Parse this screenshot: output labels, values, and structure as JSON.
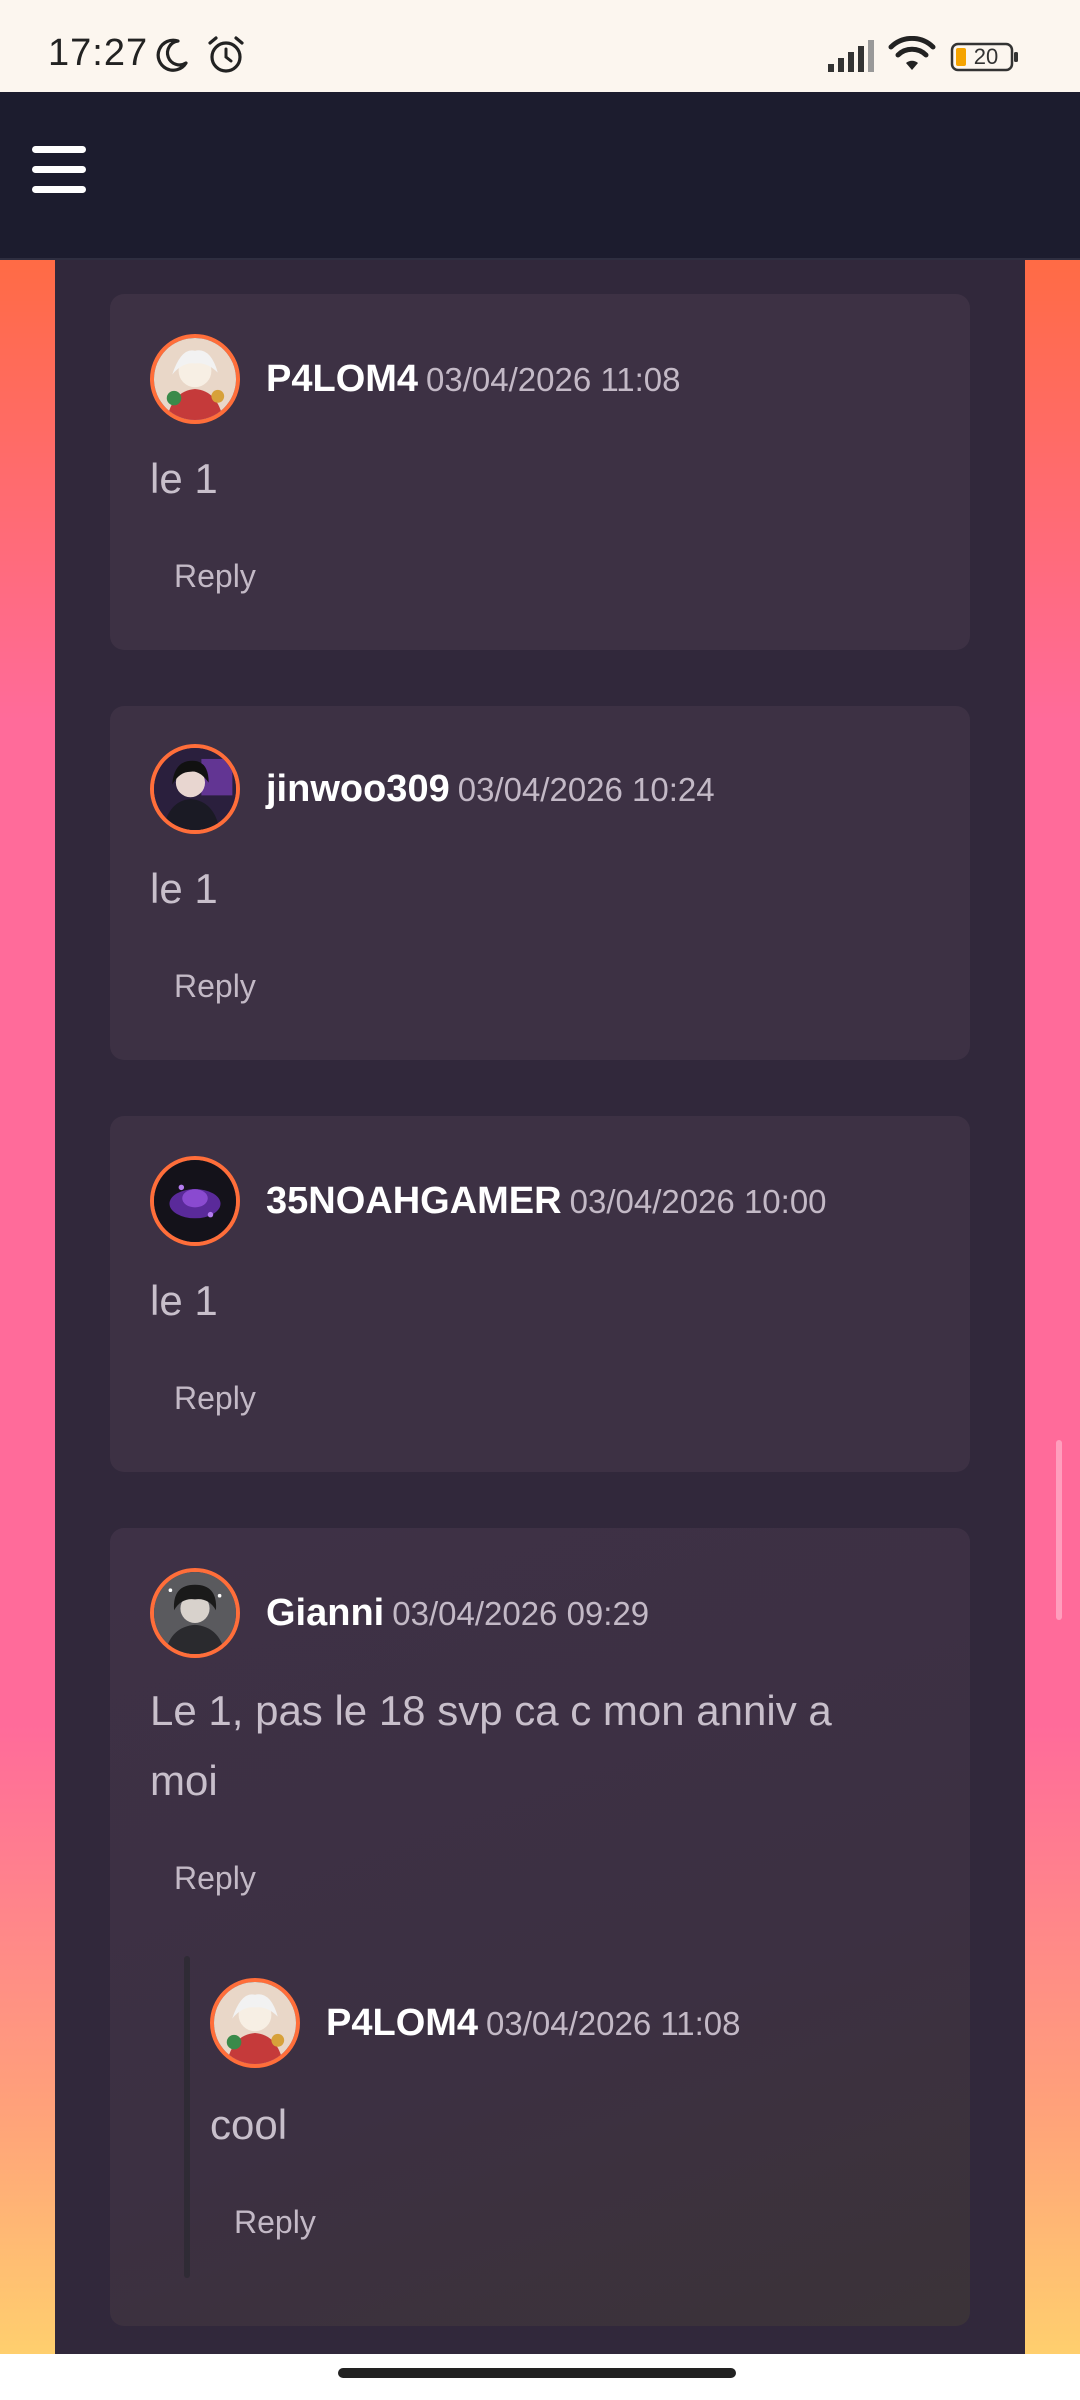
{
  "status_bar": {
    "time": "17:27",
    "battery_level": "20",
    "icons": [
      "moon-icon",
      "alarm-icon",
      "signal-icon",
      "wifi-icon",
      "battery-icon"
    ]
  },
  "app_bar": {
    "menu_icon": "hamburger-menu-icon"
  },
  "colors": {
    "accent": "#ff6e3a",
    "card_background": "#3d3144",
    "column_background": "#31283b",
    "app_bar": "#1c1c2e"
  },
  "comments": [
    {
      "username": "P4LOM4",
      "timestamp": "03/04/2026 11:08",
      "text": "le 1",
      "reply_label": "Reply"
    },
    {
      "username": "jinwoo309",
      "timestamp": "03/04/2026 10:24",
      "text": "le 1",
      "reply_label": "Reply"
    },
    {
      "username": "35NOAHGAMER",
      "timestamp": "03/04/2026 10:00",
      "text": "le 1",
      "reply_label": "Reply"
    },
    {
      "username": "Gianni",
      "timestamp": "03/04/2026 09:29",
      "text_line1": "Le 1, pas le 18 svp ca c mon anniv a",
      "text_line2": "moi",
      "reply_label": "Reply",
      "replies": [
        {
          "username": "P4LOM4",
          "timestamp": "03/04/2026 11:08",
          "text": "cool",
          "reply_label": "Reply"
        }
      ]
    }
  ]
}
